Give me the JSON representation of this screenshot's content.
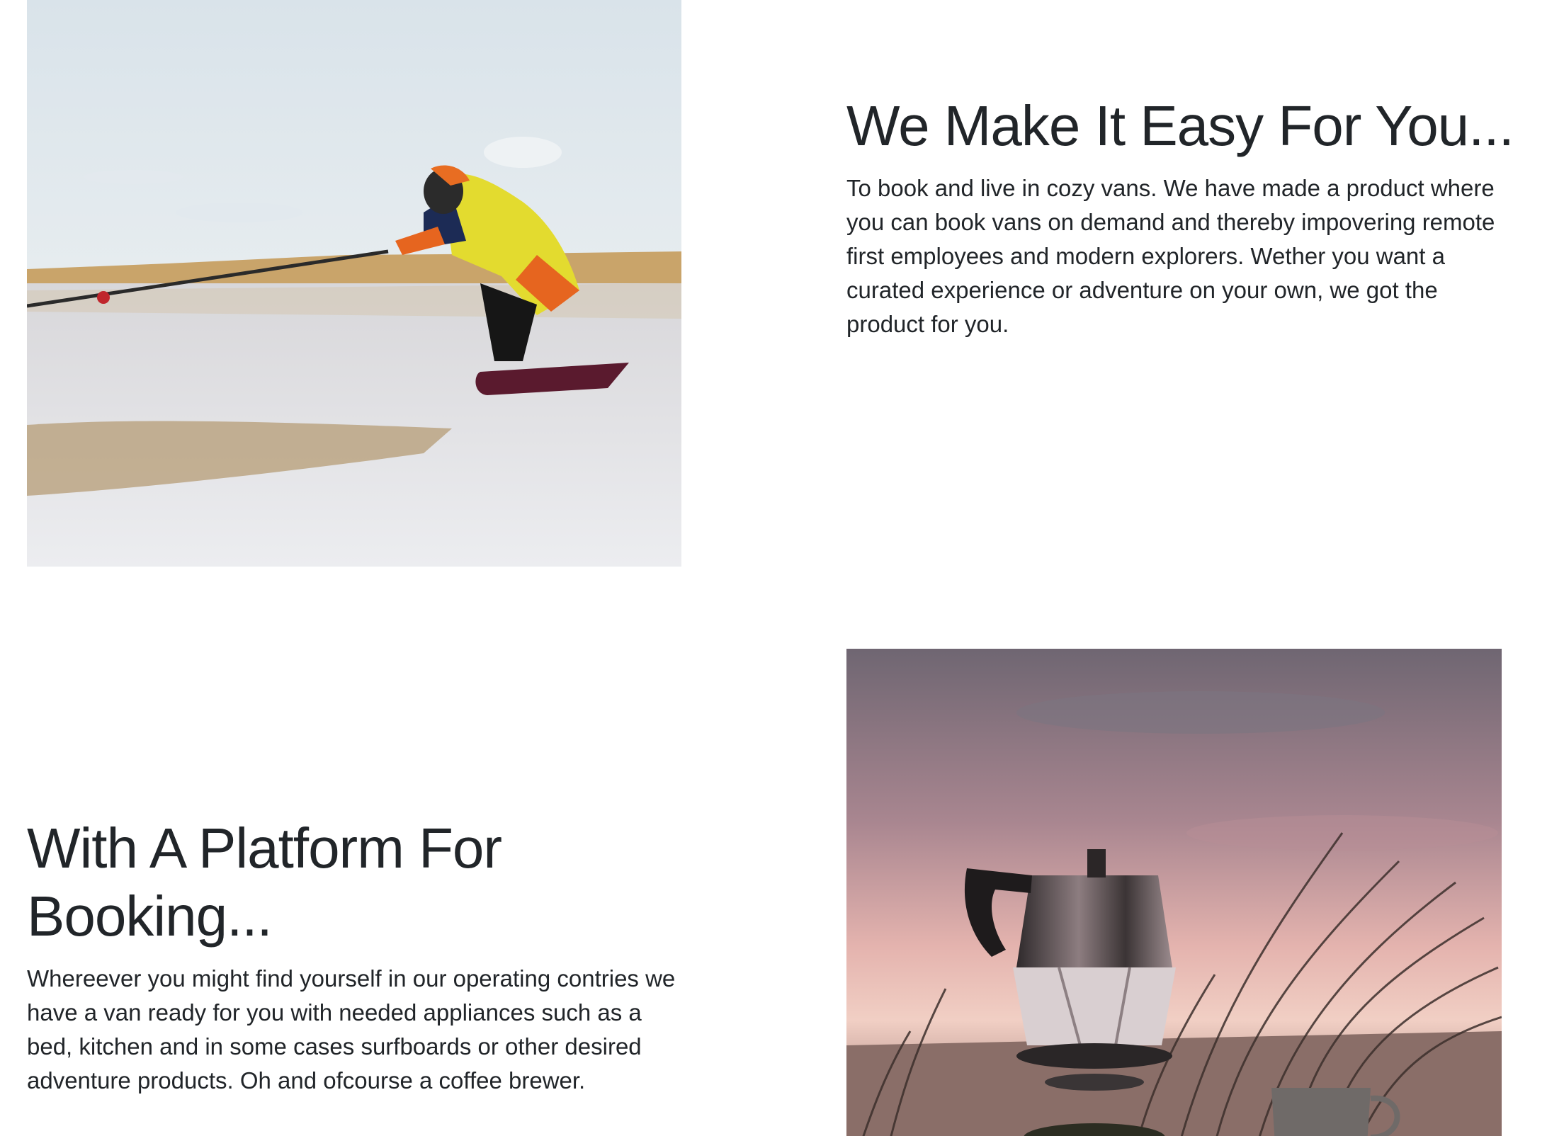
{
  "sections": [
    {
      "image": {
        "alt": "snowkiter-photo",
        "icon": "photo"
      },
      "heading": "We Make It Easy For You...",
      "text": "To book and live in cozy vans. We have made a product where you can book vans on demand and thereby impovering remote first employees and modern explorers. Wether you want a curated experience or adventure on your own, we got the product for you."
    },
    {
      "image": {
        "alt": "coffee-brewer-photo",
        "icon": "photo"
      },
      "heading": "With A Platform For Booking...",
      "text": "Whereever you might find yourself in our operating contries we have a van ready for you with needed appliances such as a bed, kitchen and in some cases surfboards or other desired adventure products. Oh and ofcourse a coffee brewer."
    }
  ],
  "colors": {
    "text": "#212529",
    "background": "#ffffff"
  }
}
